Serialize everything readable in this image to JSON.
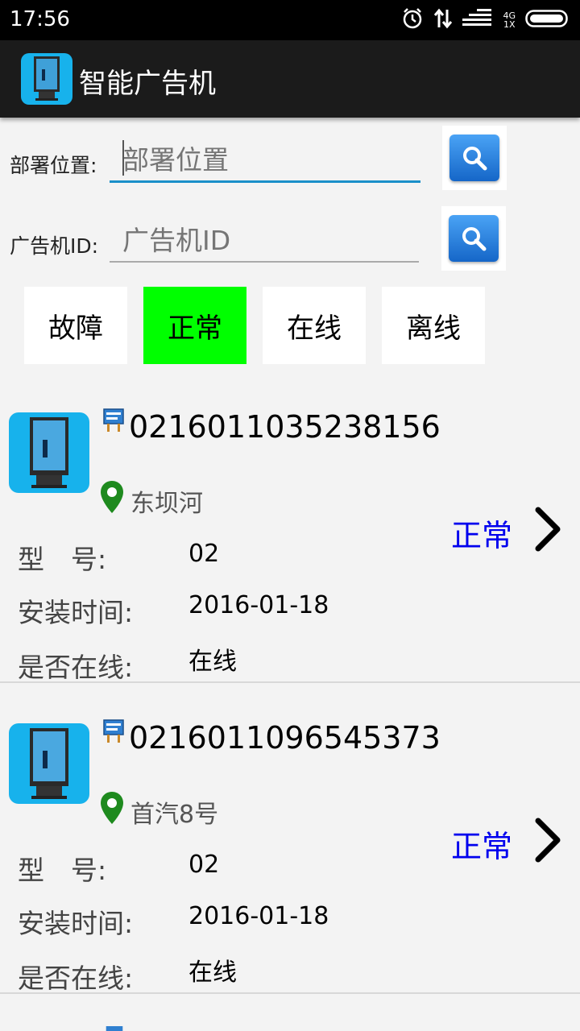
{
  "statusbar": {
    "time": "17:56",
    "net_top": "4G",
    "net_bottom": "1X"
  },
  "app": {
    "title": "智能广告机"
  },
  "search": {
    "location_label": "部署位置:",
    "location_placeholder": "部署位置",
    "id_label": "广告机ID:",
    "id_placeholder": "广告机ID"
  },
  "filters": [
    {
      "label": "故障",
      "active": false
    },
    {
      "label": "正常",
      "active": true
    },
    {
      "label": "在线",
      "active": false
    },
    {
      "label": "离线",
      "active": false
    }
  ],
  "field_labels": {
    "model": "型　号:",
    "install": "安装时间:",
    "online": "是否在线:"
  },
  "devices": [
    {
      "id": "0216011035238156",
      "location": "东坝河",
      "model": "02",
      "install_date": "2016-01-18",
      "online": "在线",
      "status": "正常"
    },
    {
      "id": "0216011096545373",
      "location": "首汽8号",
      "model": "02",
      "install_date": "2016-01-18",
      "online": "在线",
      "status": "正常"
    }
  ],
  "colors": {
    "active_filter": "#00ff00",
    "status_text": "#0000ee",
    "appbar": "#1b1b1b",
    "focus_underline": "#1a8fc9"
  }
}
